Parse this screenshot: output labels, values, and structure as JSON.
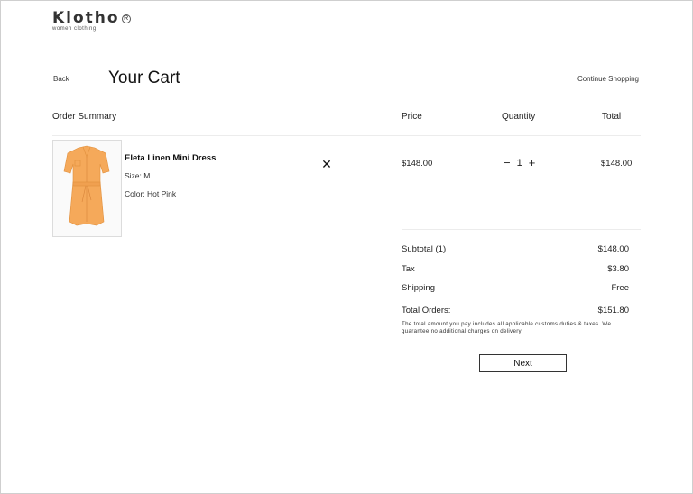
{
  "brand": {
    "name": "Klotho",
    "reg_mark": "R",
    "tagline": "women clothing"
  },
  "nav": {
    "back_label": "Back",
    "continue_label": "Continue Shopping"
  },
  "page": {
    "title": "Your Cart"
  },
  "columns": {
    "summary": "Order Summary",
    "price": "Price",
    "quantity": "Quantity",
    "total": "Total"
  },
  "cart": {
    "items": [
      {
        "name": "Eleta Linen Mini Dress",
        "size": "Size: M",
        "color": "Color: Hot Pink",
        "price": "$148.00",
        "quantity": "1",
        "total": "$148.00",
        "remove_icon": "close-icon",
        "image_color": "#f5a95a"
      }
    ]
  },
  "summary": {
    "subtotal_label": "Subtotal (1)",
    "subtotal_value": "$148.00",
    "tax_label": "Tax",
    "tax_value": "$3.80",
    "shipping_label": "Shipping",
    "shipping_value": "Free",
    "total_label": "Total Orders:",
    "total_value": "$151.80",
    "note": "The total amount you pay includes all applicable customs duties & taxes. We guarantee no additional charges on delivery"
  },
  "actions": {
    "next_label": "Next"
  },
  "qty_controls": {
    "minus": "−",
    "plus": "+"
  },
  "remove_glyph": "✕"
}
